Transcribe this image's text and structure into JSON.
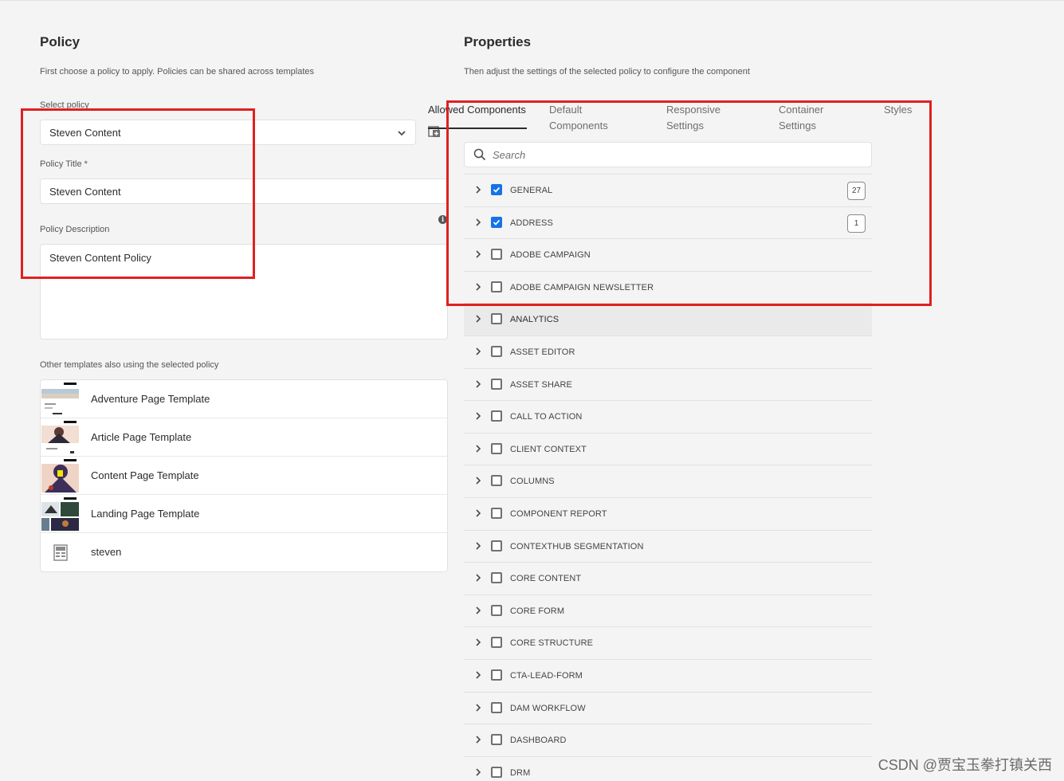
{
  "policy": {
    "heading": "Policy",
    "description": "First choose a policy to apply. Policies can be shared across templates",
    "select_label": "Select policy",
    "select_value": "Steven Content",
    "title_label": "Policy Title *",
    "title_value": "Steven Content",
    "description_label": "Policy Description",
    "description_value": "Steven Content Policy",
    "templates_label": "Other templates also using the selected policy",
    "templates": [
      {
        "name": "Adventure Page Template"
      },
      {
        "name": "Article Page Template"
      },
      {
        "name": "Content Page Template"
      },
      {
        "name": "Landing Page Template"
      },
      {
        "name": "steven"
      }
    ]
  },
  "properties": {
    "heading": "Properties",
    "description": "Then adjust the settings of the selected policy to configure the component",
    "tabs": [
      {
        "label": "Allowed Components",
        "active": true
      },
      {
        "label": "Default Components",
        "active": false
      },
      {
        "label": "Responsive Settings",
        "active": false
      },
      {
        "label": "Container Settings",
        "active": false
      },
      {
        "label": "Styles",
        "active": false
      }
    ],
    "search_placeholder": "Search",
    "groups": [
      {
        "name": "GENERAL",
        "checked": true,
        "count": "27"
      },
      {
        "name": "ADDRESS",
        "checked": true,
        "count": "1"
      },
      {
        "name": "ADOBE CAMPAIGN",
        "checked": false,
        "count": ""
      },
      {
        "name": "ADOBE CAMPAIGN NEWSLETTER",
        "checked": false,
        "count": ""
      },
      {
        "name": "ANALYTICS",
        "checked": false,
        "count": "",
        "hover": true
      },
      {
        "name": "ASSET EDITOR",
        "checked": false,
        "count": ""
      },
      {
        "name": "ASSET SHARE",
        "checked": false,
        "count": ""
      },
      {
        "name": "CALL TO ACTION",
        "checked": false,
        "count": ""
      },
      {
        "name": "CLIENT CONTEXT",
        "checked": false,
        "count": ""
      },
      {
        "name": "COLUMNS",
        "checked": false,
        "count": ""
      },
      {
        "name": "COMPONENT REPORT",
        "checked": false,
        "count": ""
      },
      {
        "name": "CONTEXTHUB SEGMENTATION",
        "checked": false,
        "count": ""
      },
      {
        "name": "CORE CONTENT",
        "checked": false,
        "count": ""
      },
      {
        "name": "CORE FORM",
        "checked": false,
        "count": ""
      },
      {
        "name": "CORE STRUCTURE",
        "checked": false,
        "count": ""
      },
      {
        "name": "CTA-LEAD-FORM",
        "checked": false,
        "count": ""
      },
      {
        "name": "DAM WORKFLOW",
        "checked": false,
        "count": ""
      },
      {
        "name": "DASHBOARD",
        "checked": false,
        "count": ""
      },
      {
        "name": "DRM",
        "checked": false,
        "count": ""
      }
    ]
  },
  "colors": {
    "accent": "#1473e6",
    "annotation": "#e02020",
    "background": "#f4f4f4"
  },
  "watermark": "CSDN @贾宝玉拳打镇关西"
}
